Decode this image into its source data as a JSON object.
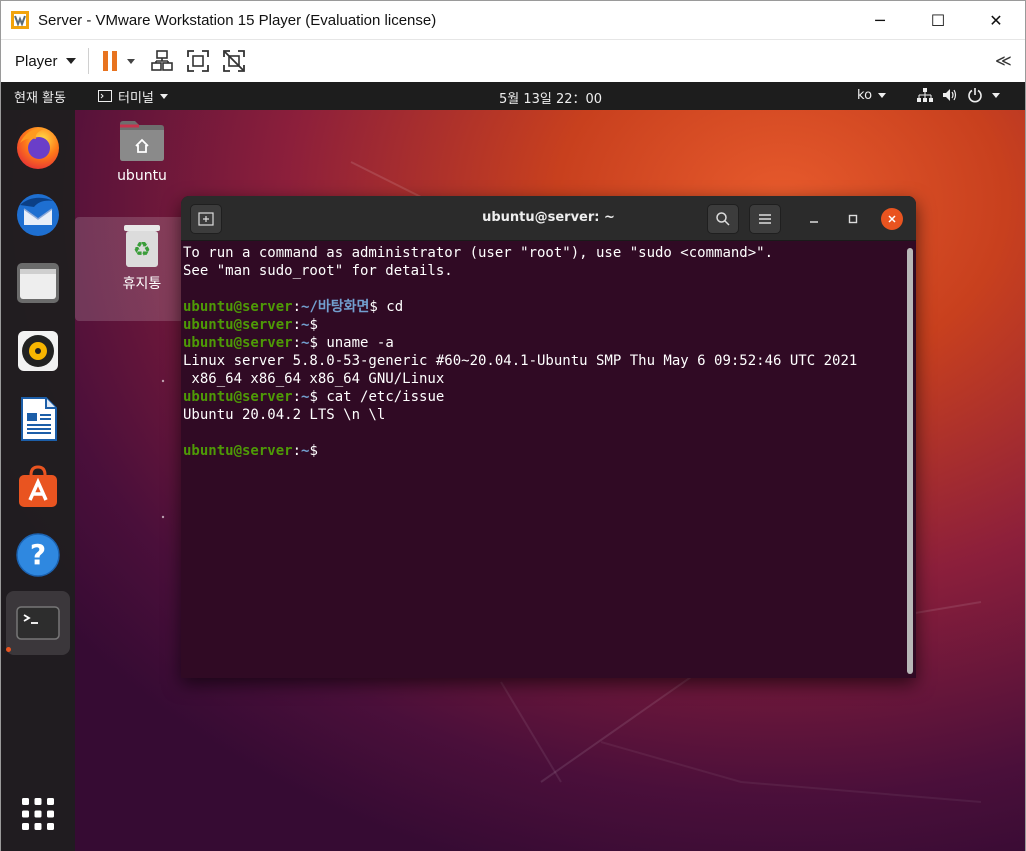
{
  "window": {
    "title": "Server - VMware Workstation 15 Player (Evaluation license)",
    "controls": {
      "minimize": "─",
      "maximize": "☐",
      "close": "✕"
    }
  },
  "toolbar": {
    "player_label": "Player",
    "collapse_glyph": "≪"
  },
  "gnome_topbar": {
    "activities": "현재 활동",
    "app_menu": "터미널",
    "clock": "5월 13일  22：00",
    "input_method": "ko"
  },
  "dock": {
    "items": [
      "firefox-icon",
      "thunderbird-icon",
      "files-icon",
      "rhythmbox-icon",
      "libreoffice-writer-icon",
      "software-center-icon",
      "help-icon",
      "terminal-icon"
    ],
    "apps_grid": "show-applications-icon"
  },
  "desktop": {
    "home_label": "ubuntu",
    "trash_label": "휴지통"
  },
  "terminal": {
    "title": "ubuntu@server: ~",
    "lines": [
      {
        "type": "text",
        "text": "To run a command as administrator (user \"root\"), use \"sudo <command>\"."
      },
      {
        "type": "text",
        "text": "See \"man sudo_root\" for details."
      },
      {
        "type": "text",
        "text": ""
      },
      {
        "type": "prompt",
        "user": "ubuntu@server",
        "path": "~/바탕화면",
        "cmd": " cd"
      },
      {
        "type": "prompt",
        "user": "ubuntu@server",
        "path": "~",
        "cmd": ""
      },
      {
        "type": "prompt",
        "user": "ubuntu@server",
        "path": "~",
        "cmd": " uname -a"
      },
      {
        "type": "text",
        "text": "Linux server 5.8.0-53-generic #60~20.04.1-Ubuntu SMP Thu May 6 09:52:46 UTC 2021"
      },
      {
        "type": "text",
        "text": " x86_64 x86_64 x86_64 GNU/Linux"
      },
      {
        "type": "prompt",
        "user": "ubuntu@server",
        "path": "~",
        "cmd": " cat /etc/issue"
      },
      {
        "type": "text",
        "text": "Ubuntu 20.04.2 LTS \\n \\l"
      },
      {
        "type": "text",
        "text": ""
      },
      {
        "type": "prompt",
        "user": "ubuntu@server",
        "path": "~",
        "cmd": ""
      }
    ]
  },
  "colors": {
    "prompt_user": "#4e9a06",
    "prompt_path": "#729fcf",
    "terminal_bg": "#300a24",
    "ubuntu_orange": "#e95420",
    "vmware_pause": "#e8731f"
  }
}
